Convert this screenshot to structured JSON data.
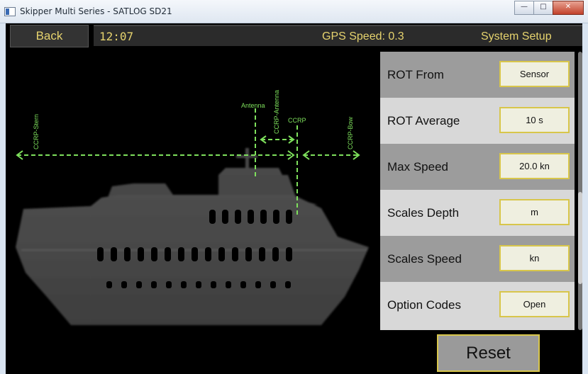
{
  "window": {
    "title": "Skipper Multi Series - SATLOG SD21"
  },
  "topbar": {
    "back_label": "Back",
    "clock": "12:07",
    "gps_speed": "GPS Speed: 0.3",
    "section": "System Setup"
  },
  "ship_diagram": {
    "labels": {
      "ccrp_stern": "CCRP-Stern",
      "antenna": "Antenna",
      "ccrp_antenna": "CCRP-Antenna",
      "ccrp": "CCRP",
      "ccrp_bow": "CCRP-Bow"
    },
    "colors": {
      "arrow": "#7ee05c",
      "hull": "#4a4a4a"
    }
  },
  "settings": [
    {
      "label": "ROT From",
      "value": "Sensor"
    },
    {
      "label": "ROT Average",
      "value": "10 s"
    },
    {
      "label": "Max Speed",
      "value": "20.0 kn"
    },
    {
      "label": "Scales Depth",
      "value": "m"
    },
    {
      "label": "Scales Speed",
      "value": "kn"
    },
    {
      "label": "Option Codes",
      "value": "Open"
    }
  ],
  "reset_label": "Reset",
  "colors": {
    "accent_text": "#e6d36e",
    "field_border": "#d8c64b"
  }
}
